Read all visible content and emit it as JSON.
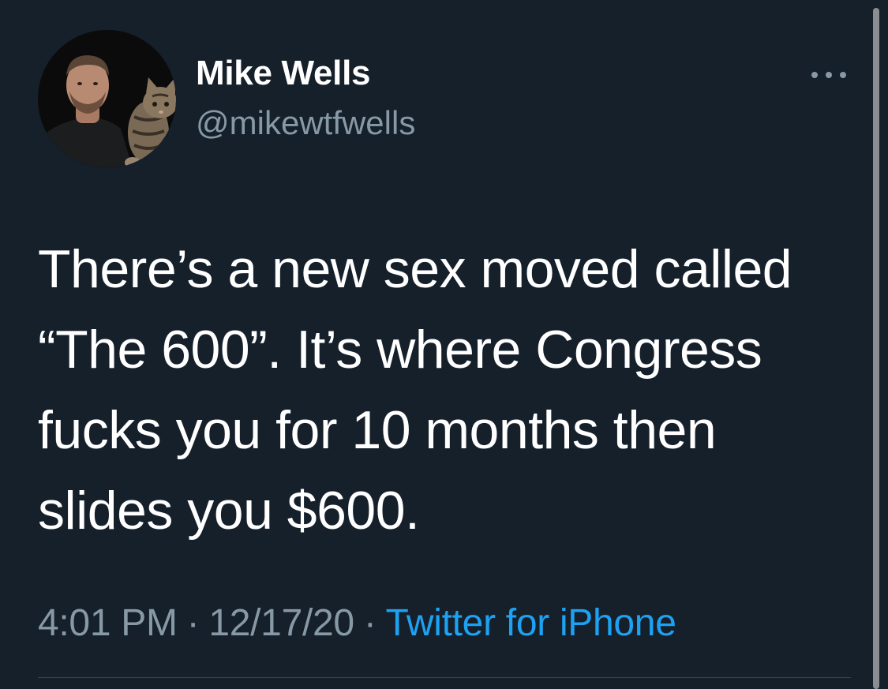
{
  "tweet": {
    "author": {
      "display_name": "Mike Wells",
      "handle": "@mikewtfwells",
      "avatar_icon": "profile-photo-man-with-cat"
    },
    "more_icon": "more-horizontal-icon",
    "text_lines": [
      "There’s a new sex moved called",
      "“The 600”. It’s where Congress",
      "fucks you for 10 months then",
      "slides you $600."
    ],
    "meta": {
      "time": "4:01 PM",
      "separator": "·",
      "date": "12/17/20",
      "source": "Twitter for iPhone"
    }
  },
  "colors": {
    "background": "#15202b",
    "primary_text": "#ffffff",
    "secondary_text": "#8899a6",
    "link": "#1da1f2",
    "divider": "#38444d"
  }
}
